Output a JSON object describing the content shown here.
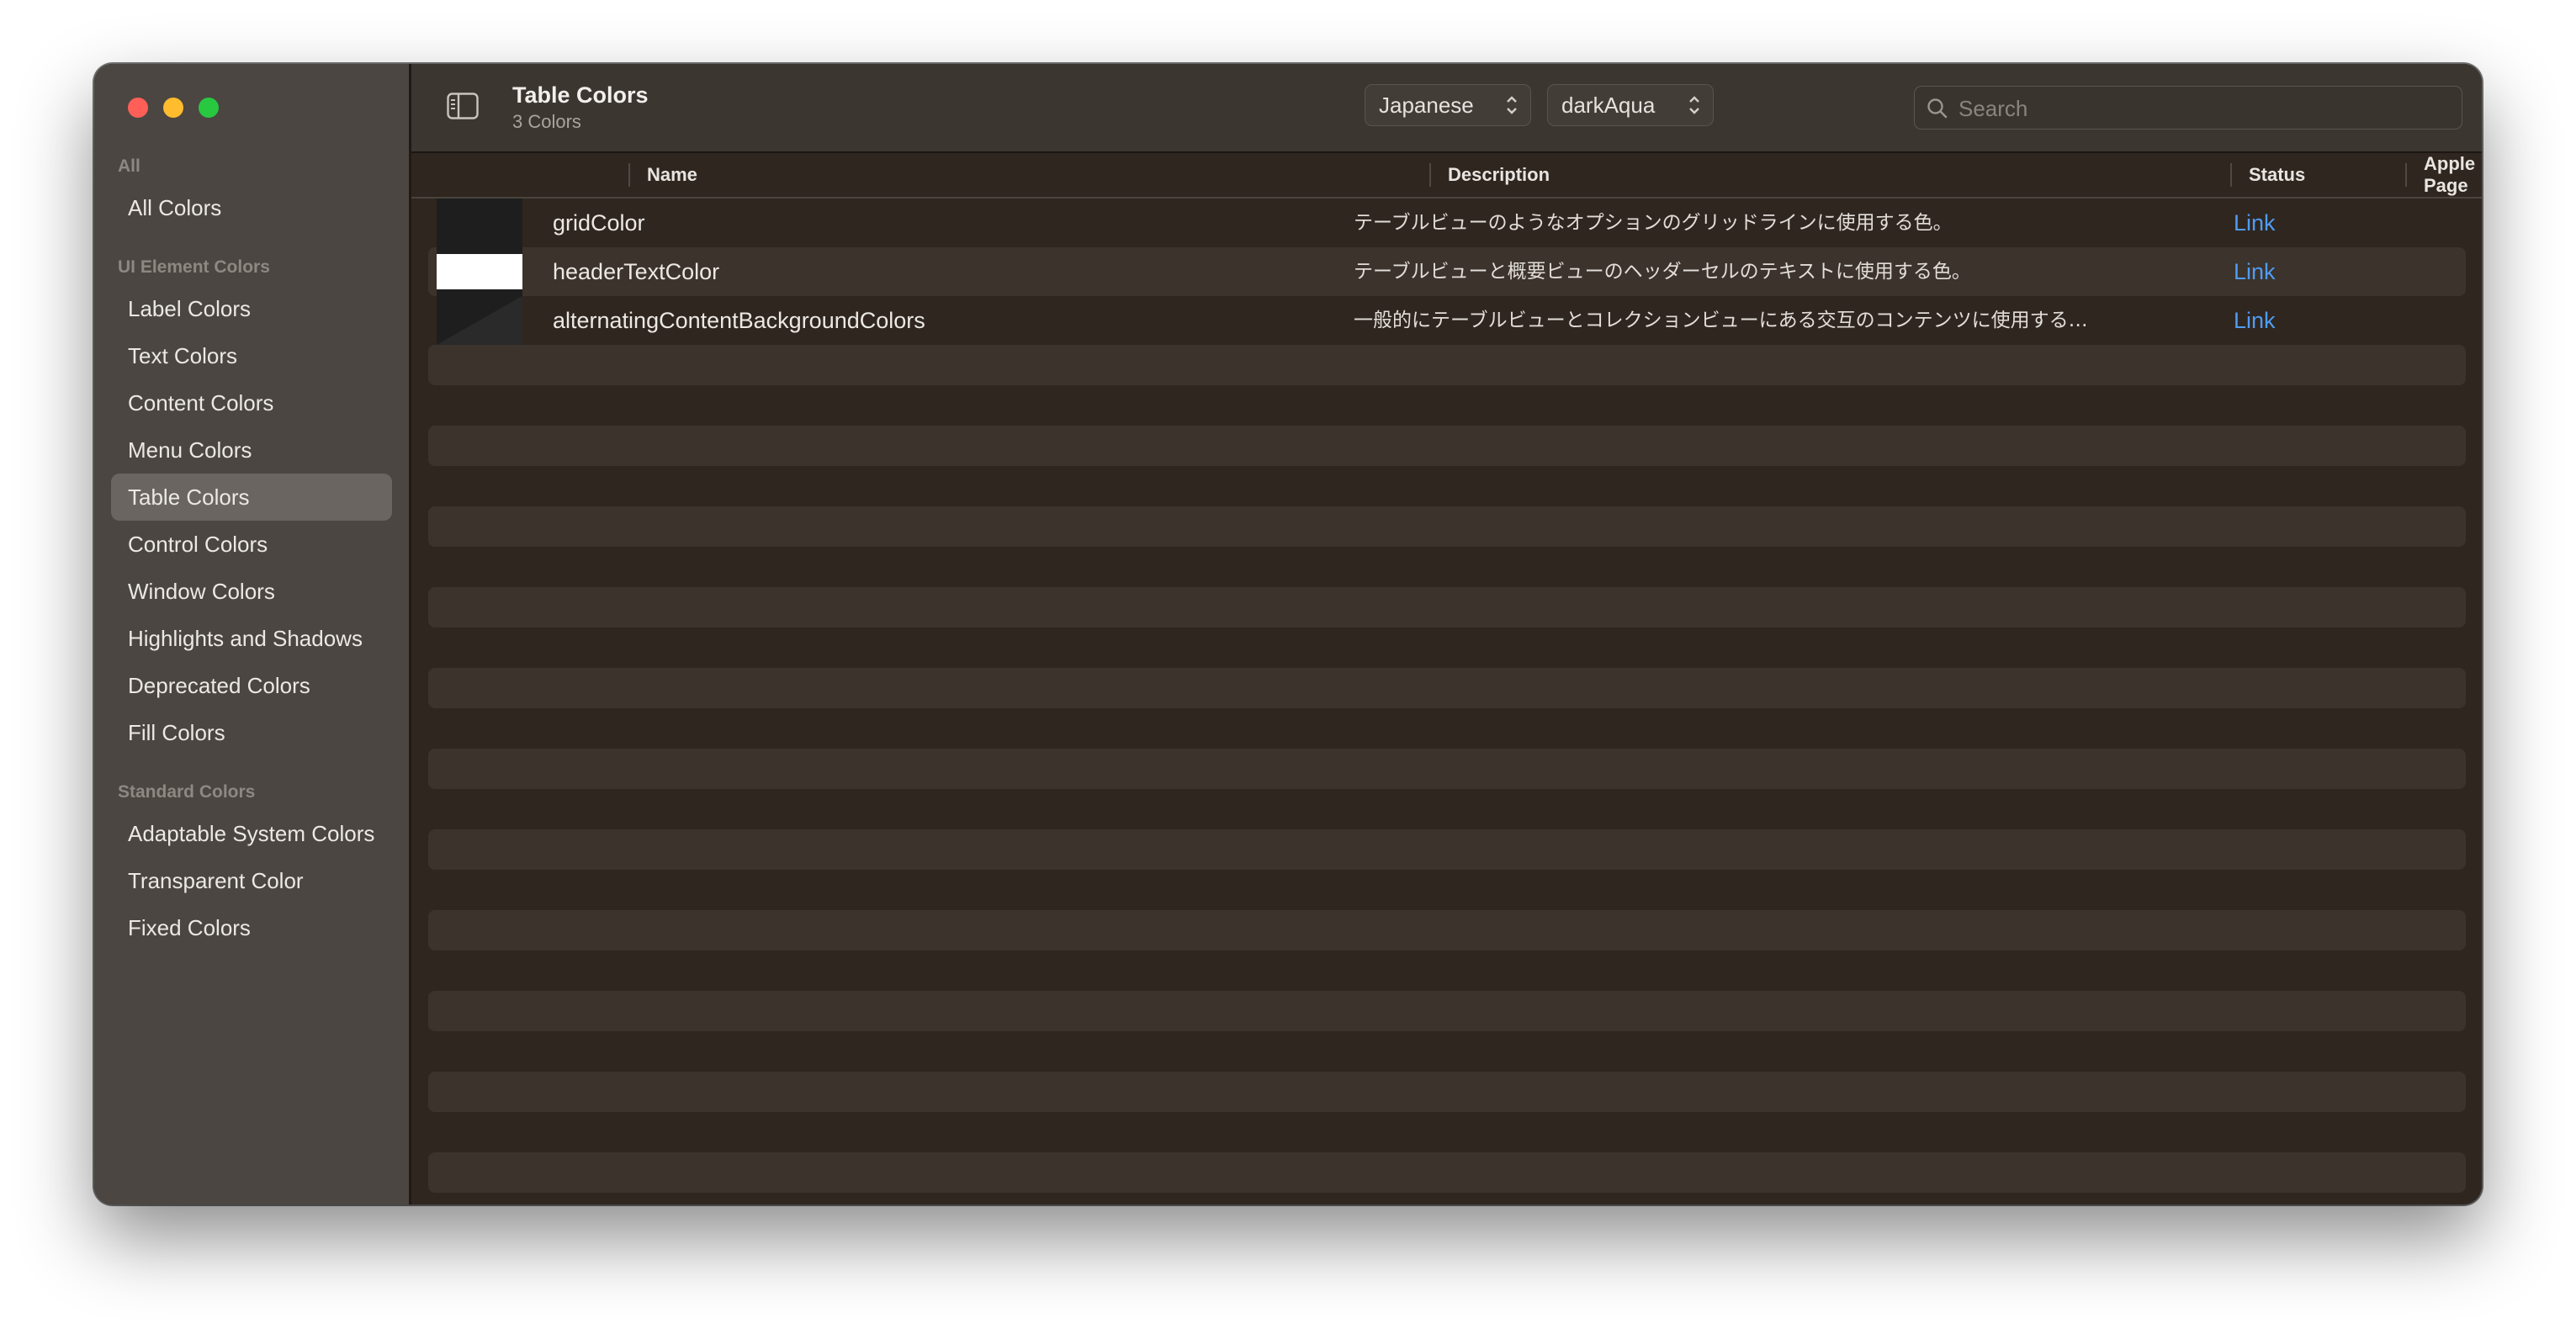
{
  "sidebar": {
    "sections": [
      {
        "header": "All",
        "items": [
          "All Colors"
        ]
      },
      {
        "header": "UI Element Colors",
        "items": [
          "Label Colors",
          "Text Colors",
          "Content Colors",
          "Menu Colors",
          "Table Colors",
          "Control Colors",
          "Window Colors",
          "Highlights and Shadows",
          "Deprecated Colors",
          "Fill Colors"
        ]
      },
      {
        "header": "Standard Colors",
        "items": [
          "Adaptable System Colors",
          "Transparent Color",
          "Fixed Colors"
        ]
      }
    ],
    "selected": "Table Colors"
  },
  "toolbar": {
    "title": "Table Colors",
    "subtitle": "3 Colors",
    "language": "Japanese",
    "appearance": "darkAqua",
    "search_placeholder": "Search"
  },
  "table": {
    "columns": [
      "Name",
      "Description",
      "Status",
      "Apple Page"
    ],
    "rows": [
      {
        "name": "gridColor",
        "description": "テーブルビューのようなオプションのグリッドラインに使用する色。",
        "status": "",
        "link": "Link",
        "swatch": [
          "#1e1e1e"
        ]
      },
      {
        "name": "headerTextColor",
        "description": "テーブルビューと概要ビューのヘッダーセルのテキストに使用する色。",
        "status": "",
        "link": "Link",
        "swatch": [
          "#ffffff"
        ]
      },
      {
        "name": "alternatingContentBackgroundColors",
        "description": "一般的にテーブルビューとコレクションビューにある交互のコンテンツに使用する…",
        "status": "",
        "link": "Link",
        "swatch": [
          "#1e1e1e",
          "#2a2a2a"
        ]
      }
    ]
  },
  "colors": {
    "traffic_red": "#ff5f57",
    "traffic_yellow": "#febc2e",
    "traffic_green": "#28c840",
    "link": "#4f9cf3",
    "selected_sidebar": "#6a6560"
  }
}
